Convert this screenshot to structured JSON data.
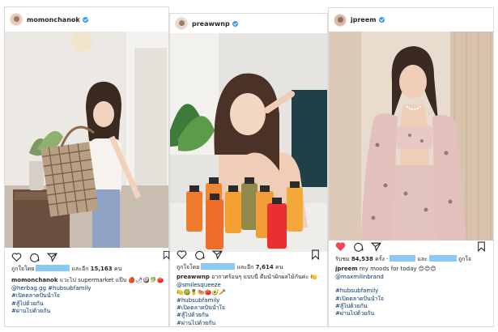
{
  "posts": [
    {
      "username": "momonchanok",
      "likes_prefix": "ถูกใจโดย",
      "likes_middle": "และอีก",
      "likes_count": "15,163",
      "likes_suffix": "คน",
      "caption_user": "momonchanok",
      "caption_text": "แวะไป supermarket แป๊บ 🍎🌶🥥🥬🍅🥦",
      "caption_mention": "@herbag.gg",
      "caption_tag": "#hubsubfamily",
      "tags": [
        "#เปิดตลาดปันน้ำใจ",
        "#สู้ไปด้วยกัน",
        "#ผ่านไปด้วยกัน"
      ]
    },
    {
      "username": "preawwnp",
      "likes_prefix": "ถูกใจโดย",
      "likes_middle": "และอีก",
      "likes_count": "7,614",
      "likes_suffix": "คน",
      "caption_user": "preawwnp",
      "caption_text": "อากาศร้อนๆ แบบนี้ ดื่มน้ำผักผลไม้กันค่ะ 🍋",
      "caption_mention": "@smilesqueeze",
      "caption_emojis": "🍋🥝🍍🍉🍅🥑🥕",
      "tags": [
        "#hubsubfamily",
        "#เปิดตลาดปันน้ำใจ",
        "#สู้ไปด้วยกัน",
        "#ผ่านไปด้วยกัน"
      ]
    },
    {
      "username": "jpreem",
      "likes_prefix": "รับชม",
      "likes_count": "84,538",
      "likes_suffix": "ครั้ง ·",
      "likes_middle": "และ",
      "likes_tail": "ถูกใจ",
      "caption_user": "jpreem",
      "caption_text": "my moods for today 😊😊😊",
      "caption_mention": "@maxmilinbrand",
      "tags": [
        "#hubsubfamily",
        "#เปิดตลาดปันน้ำใจ",
        "#สู้ไปด้วยกัน",
        "#ผ่านไปด้วยกัน"
      ]
    }
  ],
  "icons": [
    "heart-icon",
    "comment-icon",
    "share-icon",
    "bookmark-icon",
    "verified-badge-icon"
  ],
  "colors": {
    "verified": "#3897f0",
    "liked_heart": "#ed4956",
    "redacted_highlight": "#8cc8f4",
    "hashtag": "#003569"
  }
}
